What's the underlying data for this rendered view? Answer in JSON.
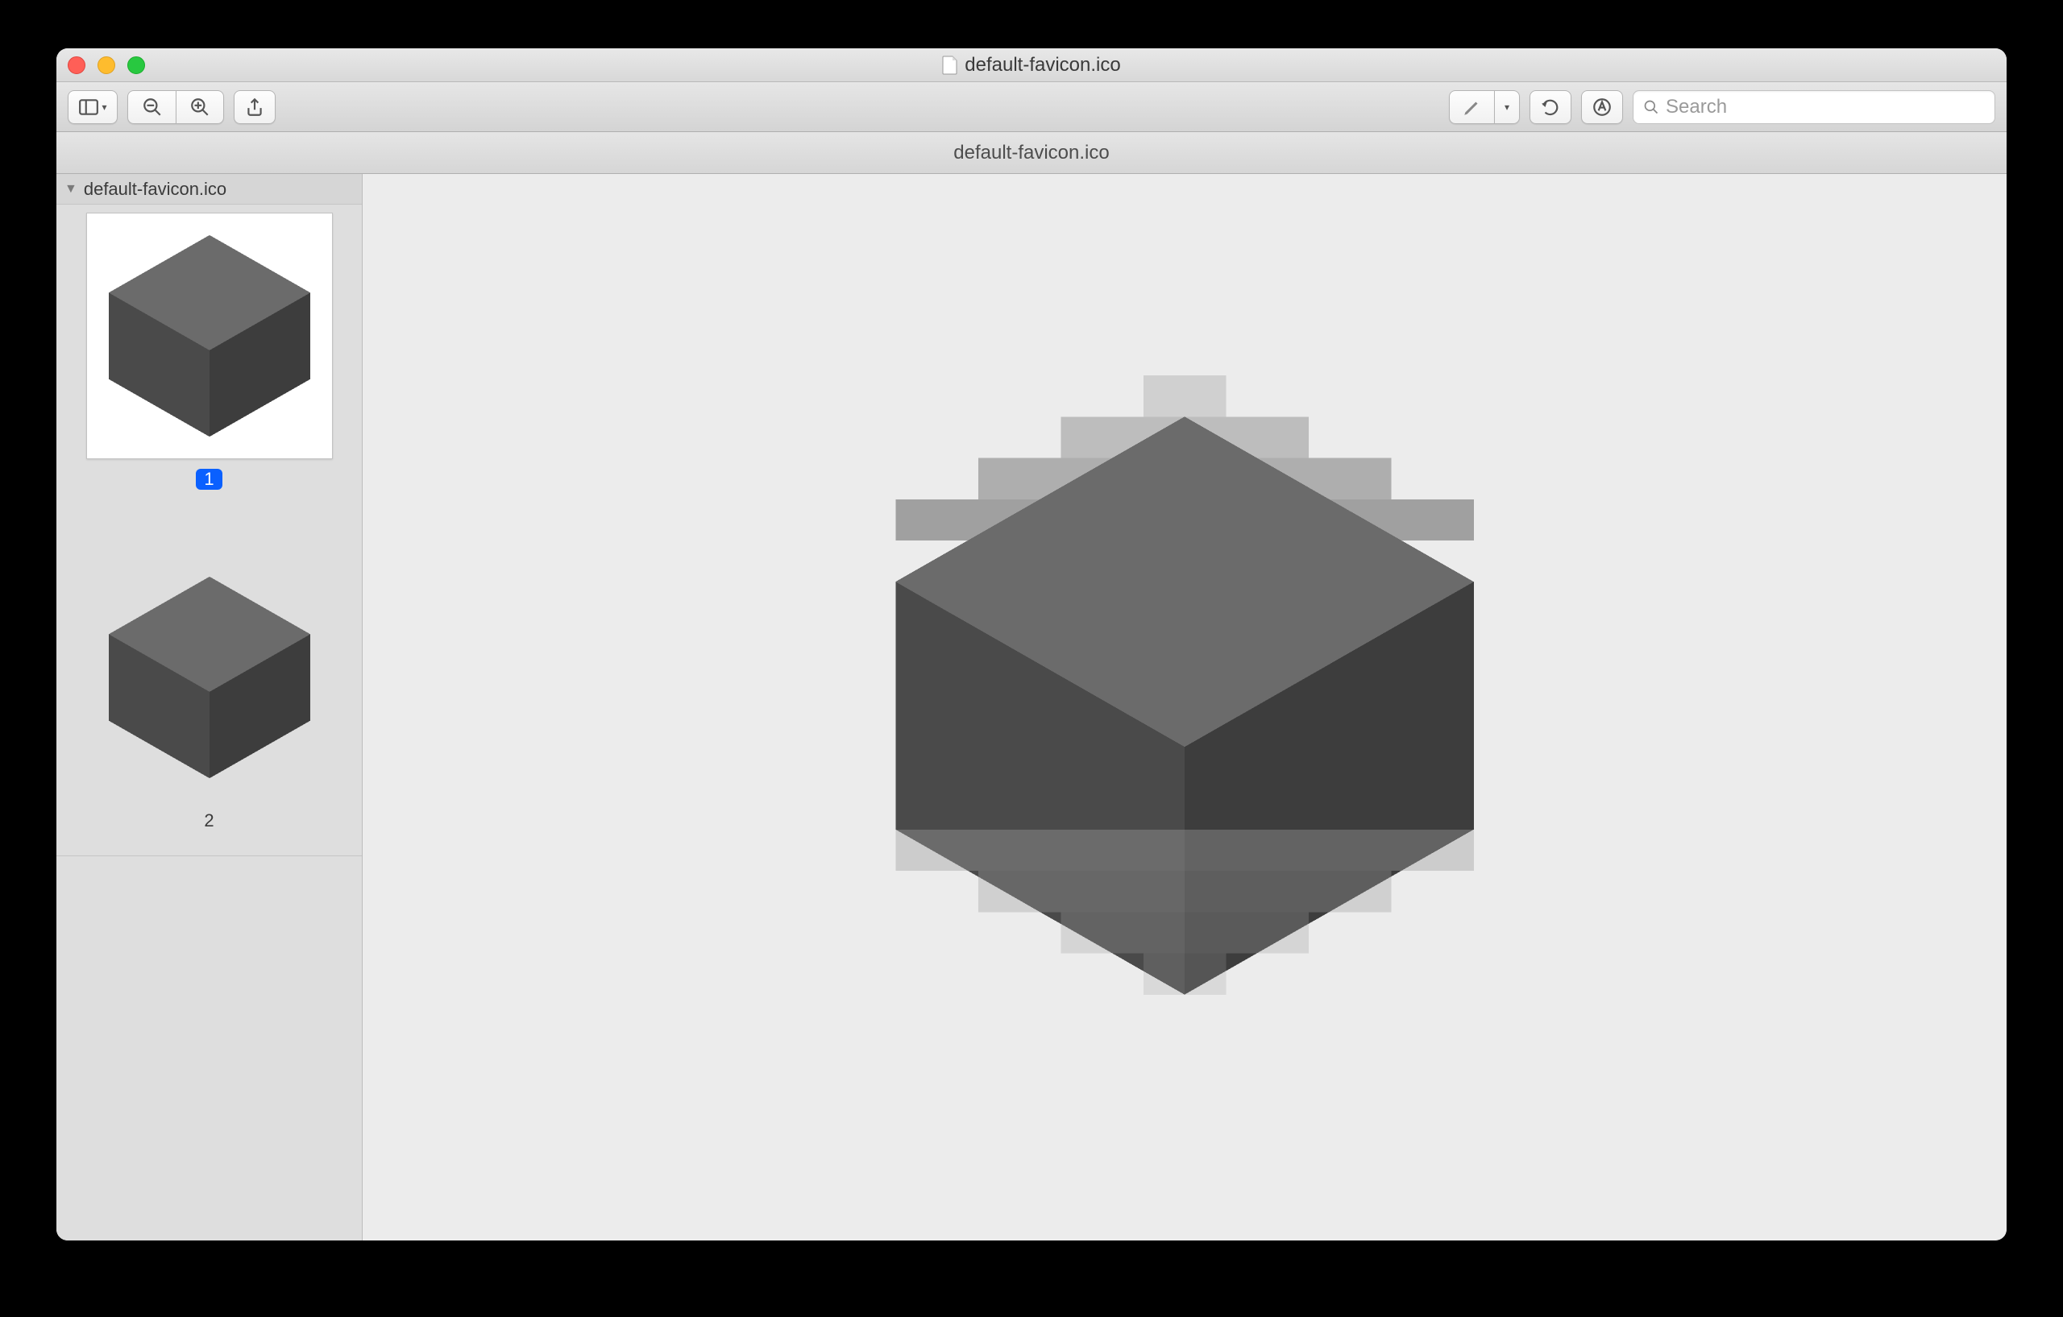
{
  "window": {
    "title": "default-favicon.ico",
    "subtitle": "default-favicon.ico"
  },
  "toolbar": {
    "search_placeholder": "Search"
  },
  "sidebar": {
    "header": "default-favicon.ico",
    "thumbs": [
      {
        "label": "1",
        "selected": true
      },
      {
        "label": "2",
        "selected": false
      }
    ]
  }
}
